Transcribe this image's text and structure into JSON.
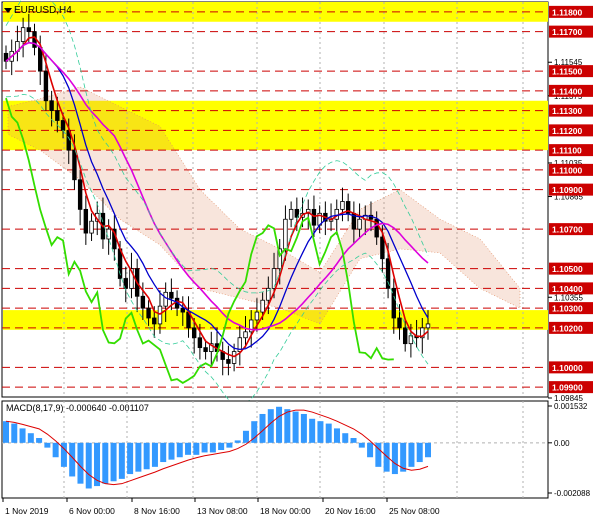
{
  "window": {
    "symbol_title": "EURUSD,H4",
    "dropdown_icon": "triangle-down-icon"
  },
  "colors": {
    "background": "#ffffff",
    "axis": "#000000",
    "grid": "#b0b0b0",
    "level_line": "#cc0000",
    "zone_fill": "#ffff00",
    "level_label_bg": "#cc0000",
    "level_label_text": "#ffffff",
    "candle": "#000000",
    "ma_red": "#dd0000",
    "ma_blue": "#0000cc",
    "ma_magenta": "#dd00dd",
    "chikou_green": "#33dd00",
    "bollinger": "#33cc99",
    "cloud_dots": "#e08a60",
    "macd_hist": "#3399ff",
    "macd_signal": "#dd0000"
  },
  "price_axis": {
    "ticks": [
      "1.11545",
      "1.11375",
      "1.11035",
      "1.10865",
      "1.10355",
      "1.09845"
    ],
    "levels": [
      "1.11800",
      "1.11700",
      "1.11500",
      "1.11400",
      "1.11300",
      "1.11200",
      "1.11100",
      "1.11000",
      "1.10900",
      "1.10700",
      "1.10500",
      "1.10400",
      "1.10300",
      "1.10200",
      "1.10000",
      "1.09900"
    ]
  },
  "time_axis": [
    "1 Nov 2019",
    "6 Nov 00:00",
    "8 Nov 16:00",
    "13 Nov 08:00",
    "18 Nov 00:00",
    "20 Nov 16:00",
    "25 Nov 08:00"
  ],
  "macd": {
    "title": "MACD(8,17,9) -0.000640 -0.001107",
    "ticks": [
      "0.001532",
      "0.00",
      "-0.002088"
    ]
  },
  "chart_data": [
    {
      "type": "candlestick",
      "title": "EURUSD,H4",
      "ylim": [
        1.0985,
        1.1185
      ],
      "x": [
        "1 Nov 2019",
        "6 Nov 00:00",
        "8 Nov 16:00",
        "13 Nov 08:00",
        "18 Nov 00:00",
        "20 Nov 16:00",
        "25 Nov 08:00"
      ],
      "horizontal_levels": [
        1.118,
        1.117,
        1.115,
        1.114,
        1.113,
        1.112,
        1.111,
        1.11,
        1.109,
        1.107,
        1.105,
        1.104,
        1.103,
        1.102,
        1.1,
        1.099
      ],
      "highlight_zones": [
        [
          1.1175,
          1.1185
        ],
        [
          1.111,
          1.1135
        ],
        [
          1.1019,
          1.1029
        ]
      ],
      "close_series": [
        1.1155,
        1.116,
        1.1165,
        1.1172,
        1.117,
        1.1162,
        1.115,
        1.1135,
        1.113,
        1.1125,
        1.112,
        1.111,
        1.1095,
        1.108,
        1.1068,
        1.1074,
        1.1078,
        1.1065,
        1.107,
        1.106,
        1.1045,
        1.104,
        1.105,
        1.1036,
        1.103,
        1.1025,
        1.1022,
        1.1031,
        1.1038,
        1.1035,
        1.103,
        1.1028,
        1.102,
        1.1015,
        1.101,
        1.1008,
        1.1012,
        1.1008,
        1.1004,
        1.1002,
        1.1008,
        1.1015,
        1.1018,
        1.1024,
        1.1028,
        1.1034,
        1.104,
        1.105,
        1.106,
        1.1075,
        1.108,
        1.1076,
        1.1078,
        1.108,
        1.1072,
        1.1078,
        1.1074,
        1.1075,
        1.108,
        1.1084,
        1.1078,
        1.107,
        1.1075,
        1.1077,
        1.1075,
        1.1066,
        1.1055,
        1.104,
        1.1025,
        1.102,
        1.1012,
        1.1016,
        1.1015,
        1.102,
        1.1022
      ]
    },
    {
      "type": "bar",
      "title": "MACD(8,17,9)",
      "ylim": [
        -0.002088,
        0.001532
      ],
      "values": [
        0.0009,
        0.0008,
        0.0006,
        0.0004,
        0.0002,
        -0.0002,
        -0.0006,
        -0.001,
        -0.0014,
        -0.0017,
        -0.0019,
        -0.0018,
        -0.0017,
        -0.0016,
        -0.0015,
        -0.0013,
        -0.0012,
        -0.0011,
        -0.001,
        -0.0008,
        -0.0007,
        -0.0006,
        -0.0005,
        -0.0005,
        -0.0004,
        -0.0004,
        -0.0003,
        -0.0002,
        0.0001,
        0.0005,
        0.0009,
        0.0012,
        0.0014,
        0.0015,
        0.0014,
        0.0013,
        0.0012,
        0.001,
        0.0009,
        0.0008,
        0.0006,
        0.0004,
        0.0002,
        -0.0002,
        -0.0006,
        -0.001,
        -0.0012,
        -0.0013,
        -0.0012,
        -0.001,
        -0.0008,
        -0.0006
      ]
    }
  ]
}
